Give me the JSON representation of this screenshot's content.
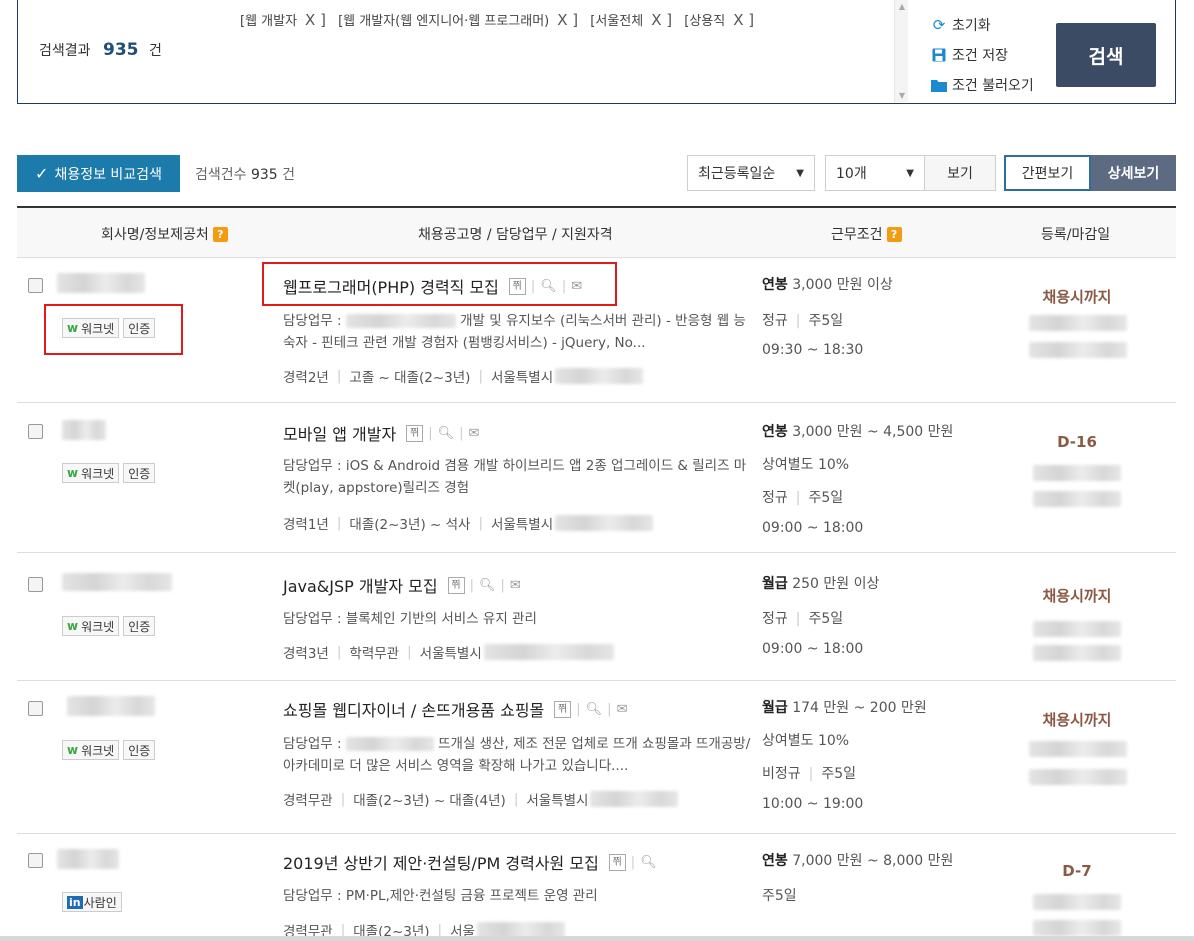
{
  "summary": {
    "result_label": "검색결과",
    "result_count": "935",
    "result_unit": "건",
    "tags": [
      "[웹 개발자",
      "[웹 개발자(웹 엔지니어·웹 프로그래머)",
      "[서울전체",
      "[상용직"
    ],
    "tag_remove": "X ]",
    "reset": "초기화",
    "save": "조건 저장",
    "load": "조건 불러오기",
    "search": "검색"
  },
  "toolbar": {
    "compare": "채용정보 비교검색",
    "count_label": "검색건수",
    "count_value": "935",
    "count_unit": "건",
    "sort_value": "최근등록일순",
    "page_size": "10개",
    "view": "보기",
    "simple_view": "간편보기",
    "detail_view": "상세보기"
  },
  "table": {
    "headers": {
      "company": "회사명/정보제공처",
      "title": "채용공고명 / 담당업무 / 지원자격",
      "conditions": "근무조건",
      "dates": "등록/마감일"
    },
    "badge_worknet": "워크넷",
    "badge_cert": "인증",
    "badge_saramin": "사람인",
    "scrap": "쮜",
    "duty_label": "담당업무 :",
    "rows": [
      {
        "title": "웹프로그래머(PHP) 경력직 모집",
        "duty": "개발 및 유지보수 (리눅스서버 관리) - 반응형 웹 능숙자 - 핀테크 관련 개발 경험자 (펌뱅킹서비스) - jQuery, No...",
        "experience": "경력2년",
        "education": "고졸 ~ 대졸(2~3년)",
        "location": "서울특별시",
        "pay_type": "연봉",
        "pay": "3,000 만원 이상",
        "employment": "정규",
        "workweek": "주5일",
        "hours": "09:30 ~ 18:30",
        "deadline": "채용시까지"
      },
      {
        "title": "모바일 앱 개발자",
        "duty": "iOS & Android 겸용 개발 하이브리드 앱 2종 업그레이드 & 릴리즈 마켓(play, appstore)릴리즈 경험",
        "experience": "경력1년",
        "education": "대졸(2~3년) ~ 석사",
        "location": "서울특별시",
        "pay_type": "연봉",
        "pay": "3,000 만원 ~ 4,500 만원",
        "pay_note": "상여별도 10%",
        "employment": "정규",
        "workweek": "주5일",
        "hours": "09:00 ~ 18:00",
        "deadline": "D-16"
      },
      {
        "title": "Java&JSP 개발자 모집",
        "duty": "블록체인 기반의 서비스 유지 관리",
        "experience": "경력3년",
        "education": "학력무관",
        "location": "서울특별시",
        "pay_type": "월급",
        "pay": "250 만원 이상",
        "employment": "정규",
        "workweek": "주5일",
        "hours": "09:00 ~ 18:00",
        "deadline": "채용시까지"
      },
      {
        "title": "쇼핑몰 웹디자이너 / 손뜨개용품 쇼핑몰",
        "duty": "뜨개실 생산, 제조 전문 업체로 뜨개 쇼핑몰과 뜨개공방/ 아카데미로 더 많은 서비스 영역을 확장해 나가고 있습니다....",
        "experience": "경력무관",
        "education": "대졸(2~3년) ~ 대졸(4년)",
        "location": "서울특별시",
        "pay_type": "월급",
        "pay": "174 만원 ~ 200 만원",
        "pay_note": "상여별도 10%",
        "employment": "비정규",
        "workweek": "주5일",
        "hours": "10:00 ~ 19:00",
        "deadline": "채용시까지"
      },
      {
        "title": "2019년 상반기 제안·컨설팅/PM 경력사원 모집",
        "duty": "PM·PL,제안·컨설팅 금융 프로젝트 운영 관리",
        "experience": "경력무관",
        "education": "대졸(2~3년)",
        "location": "서울",
        "pay_type": "연봉",
        "pay": "7,000 만원 ~ 8,000 만원",
        "workweek": "주5일",
        "deadline": "D-7"
      }
    ]
  },
  "colors": {
    "brand": "#1d7bab",
    "search_button": "#3c4b64",
    "deadline": "#8b5a44",
    "highlight": "#e01b1b"
  }
}
